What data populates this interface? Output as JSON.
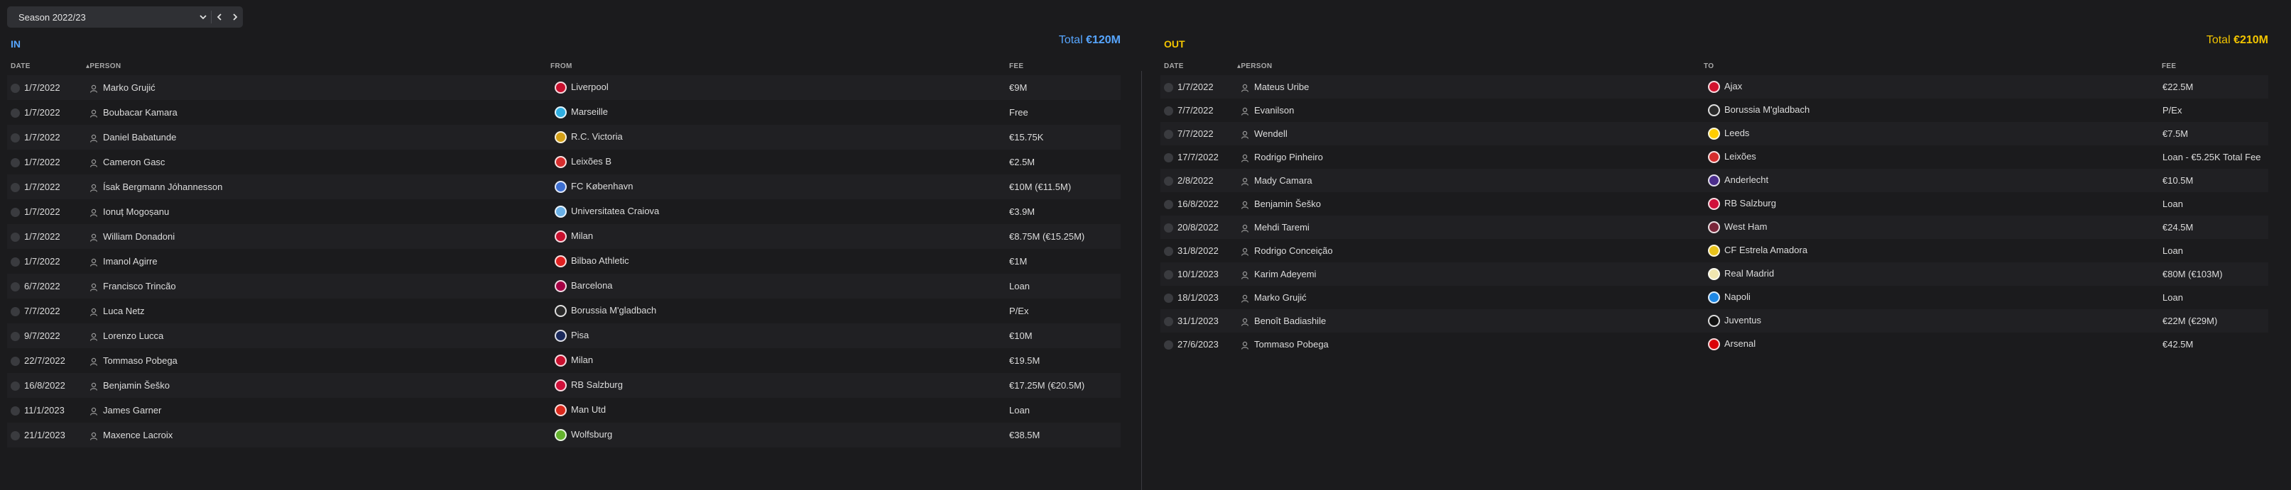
{
  "season_selector": {
    "value": "Season 2022/23"
  },
  "in": {
    "title": "IN",
    "total_label": "Total",
    "total_value": "€120M",
    "columns": {
      "date": "DATE",
      "person": "PERSON",
      "club": "FROM",
      "fee": "FEE"
    },
    "rows": [
      {
        "date": "1/7/2022",
        "person": "Marko Grujić",
        "club": "Liverpool",
        "fee": "€9M",
        "crest": "#c8102e"
      },
      {
        "date": "1/7/2022",
        "person": "Boubacar Kamara",
        "club": "Marseille",
        "fee": "Free",
        "crest": "#2faee0"
      },
      {
        "date": "1/7/2022",
        "person": "Daniel Babatunde",
        "club": "R.C. Victoria",
        "fee": "€15.75K",
        "crest": "#d4a017"
      },
      {
        "date": "1/7/2022",
        "person": "Cameron Gasc",
        "club": "Leixões B",
        "fee": "€2.5M",
        "crest": "#d62d2d"
      },
      {
        "date": "1/7/2022",
        "person": "Ísak Bergmann Jóhannesson",
        "club": "FC København",
        "fee": "€10M (€11.5M)",
        "crest": "#3d6fd1"
      },
      {
        "date": "1/7/2022",
        "person": "Ionuț Mogoșanu",
        "club": "Universitatea Craiova",
        "fee": "€3.9M",
        "crest": "#6ab0e6"
      },
      {
        "date": "1/7/2022",
        "person": "William Donadoni",
        "club": "Milan",
        "fee": "€8.75M (€15.25M)",
        "crest": "#c8102e"
      },
      {
        "date": "1/7/2022",
        "person": "Imanol Agirre",
        "club": "Bilbao Athletic",
        "fee": "€1M",
        "crest": "#e02020"
      },
      {
        "date": "6/7/2022",
        "person": "Francisco Trincão",
        "club": "Barcelona",
        "fee": "Loan",
        "crest": "#a50044"
      },
      {
        "date": "7/7/2022",
        "person": "Luca Netz",
        "club": "Borussia M'gladbach",
        "fee": "P/Ex",
        "crest": "#2a2a2a"
      },
      {
        "date": "9/7/2022",
        "person": "Lorenzo Lucca",
        "club": "Pisa",
        "fee": "€10M",
        "crest": "#1b2a5c"
      },
      {
        "date": "22/7/2022",
        "person": "Tommaso Pobega",
        "club": "Milan",
        "fee": "€19.5M",
        "crest": "#c8102e"
      },
      {
        "date": "16/8/2022",
        "person": "Benjamin Šeško",
        "club": "RB Salzburg",
        "fee": "€17.25M (€20.5M)",
        "crest": "#d0103a"
      },
      {
        "date": "11/1/2023",
        "person": "James Garner",
        "club": "Man Utd",
        "fee": "Loan",
        "crest": "#da291c"
      },
      {
        "date": "21/1/2023",
        "person": "Maxence Lacroix",
        "club": "Wolfsburg",
        "fee": "€38.5M",
        "crest": "#65b32e"
      }
    ]
  },
  "out": {
    "title": "OUT",
    "total_label": "Total",
    "total_value": "€210M",
    "columns": {
      "date": "DATE",
      "person": "PERSON",
      "club": "TO",
      "fee": "FEE"
    },
    "rows": [
      {
        "date": "1/7/2022",
        "person": "Mateus Uribe",
        "club": "Ajax",
        "fee": "€22.5M",
        "crest": "#d2122e"
      },
      {
        "date": "7/7/2022",
        "person": "Evanilson",
        "club": "Borussia M'gladbach",
        "fee": "P/Ex",
        "crest": "#2a2a2a"
      },
      {
        "date": "7/7/2022",
        "person": "Wendell",
        "club": "Leeds",
        "fee": "€7.5M",
        "crest": "#ffcd00"
      },
      {
        "date": "17/7/2022",
        "person": "Rodrigo Pinheiro",
        "club": "Leixões",
        "fee": "Loan - €5.25K Total Fee",
        "crest": "#d62d2d"
      },
      {
        "date": "2/8/2022",
        "person": "Mady Camara",
        "club": "Anderlecht",
        "fee": "€10.5M",
        "crest": "#4b2d8c"
      },
      {
        "date": "16/8/2022",
        "person": "Benjamin Šeško",
        "club": "RB Salzburg",
        "fee": "Loan",
        "crest": "#d0103a"
      },
      {
        "date": "20/8/2022",
        "person": "Mehdi Taremi",
        "club": "West Ham",
        "fee": "€24.5M",
        "crest": "#7a263a"
      },
      {
        "date": "31/8/2022",
        "person": "Rodrigo Conceição",
        "club": "CF Estrela Amadora",
        "fee": "Loan",
        "crest": "#e8c21a"
      },
      {
        "date": "10/1/2023",
        "person": "Karim Adeyemi",
        "club": "Real Madrid",
        "fee": "€80M (€103M)",
        "crest": "#f0e6b0"
      },
      {
        "date": "18/1/2023",
        "person": "Marko Grujić",
        "club": "Napoli",
        "fee": "Loan",
        "crest": "#1e88e5"
      },
      {
        "date": "31/1/2023",
        "person": "Benoît Badiashile",
        "club": "Juventus",
        "fee": "€22M (€29M)",
        "crest": "#111111"
      },
      {
        "date": "27/6/2023",
        "person": "Tommaso Pobega",
        "club": "Arsenal",
        "fee": "€42.5M",
        "crest": "#db0007"
      }
    ]
  }
}
